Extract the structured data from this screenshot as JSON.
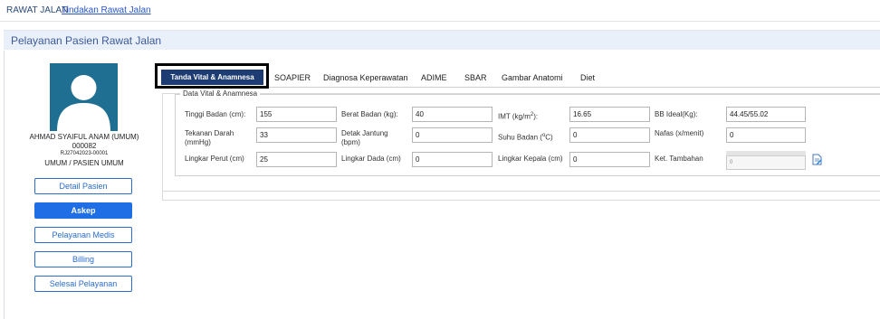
{
  "breadcrumb": {
    "root": "RAWAT JALAN",
    "current": "Tindakan Rawat Jalan"
  },
  "panel": {
    "title": "Pelayanan Pasien Rawat Jalan"
  },
  "patient": {
    "name": "AHMAD SYAIFUL ANAM (UMUM)",
    "number": "000082",
    "registration": "RJ27042023-00001",
    "type": "UMUM / PASIEN UMUM"
  },
  "sidebar": {
    "buttons": [
      {
        "label": "Detail Pasien",
        "active": false
      },
      {
        "label": "Askep",
        "active": true
      },
      {
        "label": "Pelayanan Medis",
        "active": false
      },
      {
        "label": "Billing",
        "active": false
      },
      {
        "label": "Selesai Pelayanan",
        "active": false
      }
    ]
  },
  "tabs": [
    {
      "label": "Tanda Vital & Anamnesa",
      "active": true
    },
    {
      "label": "SOAPIER",
      "active": false
    },
    {
      "label": "Diagnosa Keperawatan",
      "active": false
    },
    {
      "label": "ADIME",
      "active": false
    },
    {
      "label": "SBAR",
      "active": false
    },
    {
      "label": "Gambar Anatomi",
      "active": false
    },
    {
      "label": "Diet",
      "active": false
    }
  ],
  "form": {
    "legend": "Data Vital & Anamnesa",
    "tinggi_badan": {
      "label": "Tinggi Badan (cm):",
      "value": "155"
    },
    "berat_badan": {
      "label": "Berat Badan (kg):",
      "value": "40"
    },
    "imt": {
      "label_prefix": "IMT (kg/m",
      "label_sup": "2",
      "label_suffix": "):",
      "value": "16.65"
    },
    "bb_ideal": {
      "label": "BB Ideal(Kg):",
      "value": "44.45/55.02"
    },
    "tekanan_darah": {
      "label_line1": "Tekanan Darah",
      "label_line2": "(mmHg)",
      "value": "33"
    },
    "detak_jantung": {
      "label_line1": "Detak Jantung",
      "label_line2": "(bpm)",
      "value": "0"
    },
    "suhu_badan": {
      "label_prefix": "Suhu Badan (",
      "label_sup": "o",
      "label_suffix": "C)",
      "value": "0"
    },
    "nafas": {
      "label": "Nafas (x/menit)",
      "value": "0"
    },
    "lingkar_perut": {
      "label": "Lingkar Perut (cm)",
      "value": "25"
    },
    "lingkar_dada": {
      "label": "Lingkar Dada (cm)",
      "value": "0"
    },
    "lingkar_kepala": {
      "label": "Lingkar Kepala (cm)",
      "value": "0"
    },
    "ket_tambahan": {
      "label": "Ket. Tambahan",
      "value": "0"
    }
  },
  "colors": {
    "active_tab": "#1d3c74",
    "active_button": "#1f6ee6",
    "avatar_bg": "#1f6f93",
    "panel_title": "#3c5a9a"
  },
  "icons": {
    "avatar": "user-silhouette-icon",
    "edit": "edit-document-icon"
  }
}
